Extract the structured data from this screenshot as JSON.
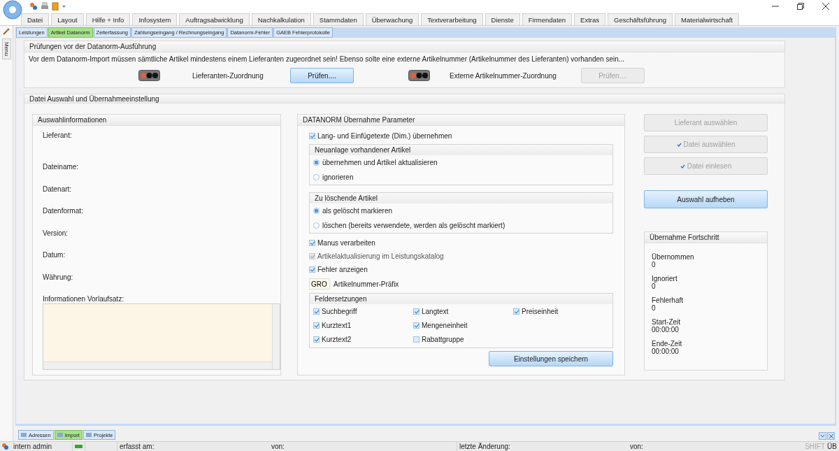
{
  "menu_tabs": [
    {
      "label": "Datei",
      "selected": false
    },
    {
      "label": "Layout",
      "selected": false
    },
    {
      "label": "Hilfe + Info",
      "selected": false
    },
    {
      "label": "Infosystem",
      "selected": false
    },
    {
      "label": "Auftragsabwicklung",
      "selected": false
    },
    {
      "label": "Nachkalkulation",
      "selected": false
    },
    {
      "label": "Stammdaten",
      "selected": false
    },
    {
      "label": "Überwachung",
      "selected": false
    },
    {
      "label": "Textverarbeitung",
      "selected": false
    },
    {
      "label": "Dienste",
      "selected": false
    },
    {
      "label": "Firmendaten",
      "selected": false
    },
    {
      "label": "Extras",
      "selected": false
    },
    {
      "label": "Geschäftsführung",
      "selected": false
    },
    {
      "label": "Materialwirtschaft",
      "selected": false
    }
  ],
  "side_tab": {
    "label": "Menu"
  },
  "sub_tabs": [
    {
      "label": "Leistungen",
      "selected": false
    },
    {
      "label": "Artikel Datanorm",
      "selected": true
    },
    {
      "label": "Zeiterfassung",
      "selected": false
    },
    {
      "label": "Zahlungseingang / Rechnungseingang",
      "selected": false
    },
    {
      "label": "Datanorm-Fehler",
      "selected": false
    },
    {
      "label": "GAEB Fehlerprotokolle",
      "selected": false
    }
  ],
  "checks": {
    "title": "Prüfungen vor der Datanorm-Ausführung",
    "notice": "Vor dem Datanorm-Import müssen sämtliche Artikel mindestens einem Lieferanten zugeordnet sein! Ebenso solte eine externe Artikelnummer (Artikelnummer des Lieferanten) vorhanden sein...",
    "rows": [
      {
        "label": "Lieferanten-Zuordnung",
        "button": "Prüfen....",
        "disabled": false
      },
      {
        "label": "Externe Artikelnummer-Zuordnung",
        "button": "Prüfen....",
        "disabled": true
      }
    ]
  },
  "file_section": {
    "title": "Datei Auswahl und Übernahmeeinstellung",
    "info": {
      "title": "Auswahlinformationen",
      "fields": [
        "Lieferant:",
        "Dateiname:",
        "Datenart:",
        "Datenformat:",
        "Version:",
        "Datum:",
        "Währung:"
      ],
      "notes_label": "Informationen Vorlaufsatz:"
    },
    "params": {
      "title": "DATANORM Übernahme Parameter",
      "items": [
        {
          "kind": "checkbox",
          "label": "Lang- und Einfügetexte (Dim.) übernehmen",
          "checked": true,
          "disabled": false
        },
        {
          "kind": "radiogroup",
          "title": "Neuanlage vorhandener Artikel",
          "options": [
            {
              "label": "übernehmen und Artikel aktualisieren",
              "selected": true
            },
            {
              "label": "ignorieren",
              "selected": false
            }
          ]
        },
        {
          "kind": "radiogroup",
          "title": "Zu löschende Artikel",
          "options": [
            {
              "label": "als gelöscht markieren",
              "selected": true
            },
            {
              "label": "löschen (bereits verwendete, werden als gelöscht markiert)",
              "selected": false
            }
          ]
        },
        {
          "kind": "checkbox",
          "label": "Manus verarbeiten",
          "checked": true,
          "disabled": false
        },
        {
          "kind": "checkbox",
          "label": "Artikelaktualisierung im Leistungskatalog",
          "checked": true,
          "disabled": true
        },
        {
          "kind": "checkbox",
          "label": "Fehler anzeigen",
          "checked": true,
          "disabled": false
        },
        {
          "kind": "textfield",
          "value": "GRO",
          "label": "Artikelnummer-Präfix"
        },
        {
          "kind": "checkgrid",
          "title": "Feldersetzungen",
          "options": [
            {
              "label": "Suchbegriff",
              "checked": true
            },
            {
              "label": "Kurztext1",
              "checked": true
            },
            {
              "label": "Kurztext2",
              "checked": true
            },
            {
              "label": "Langtext",
              "checked": true
            },
            {
              "label": "Mengeneinheit",
              "checked": true
            },
            {
              "label": "Rabattgruppe",
              "checked": false
            },
            {
              "label": "Preiseinheit",
              "checked": true
            }
          ]
        }
      ],
      "save_button": "Einstellungen speichern"
    },
    "actions": [
      {
        "label": "Lieferant auswählen",
        "disabled": true,
        "tick": false
      },
      {
        "label": "Datei auswählen",
        "disabled": true,
        "tick": true
      },
      {
        "label": "Datei einlesen",
        "disabled": true,
        "tick": true
      }
    ],
    "clear_button": "Auswahl aufheben",
    "progress": {
      "title": "Übernahme Fortschritt",
      "items": [
        {
          "label": "Übernommen",
          "value": "0"
        },
        {
          "label": "Ignoriert",
          "value": "0"
        },
        {
          "label": "Fehlerhaft",
          "value": "0"
        },
        {
          "label": "Start-Zeit",
          "value": "00:00:00"
        },
        {
          "label": "Ende-Zeit",
          "value": "00:00:00"
        }
      ]
    }
  },
  "bottom_tabs": [
    {
      "label": "Adressen",
      "selected": false
    },
    {
      "label": "Import",
      "selected": true
    },
    {
      "label": "Projekte",
      "selected": false
    }
  ],
  "status_bar": {
    "user": "intern admin",
    "fields": [
      "erfasst am:",
      "von:",
      "letzte Änderung:",
      "von:"
    ],
    "keys": [
      {
        "label": "SHIFT",
        "on": false
      },
      {
        "label": "ÜB",
        "on": true
      }
    ]
  }
}
